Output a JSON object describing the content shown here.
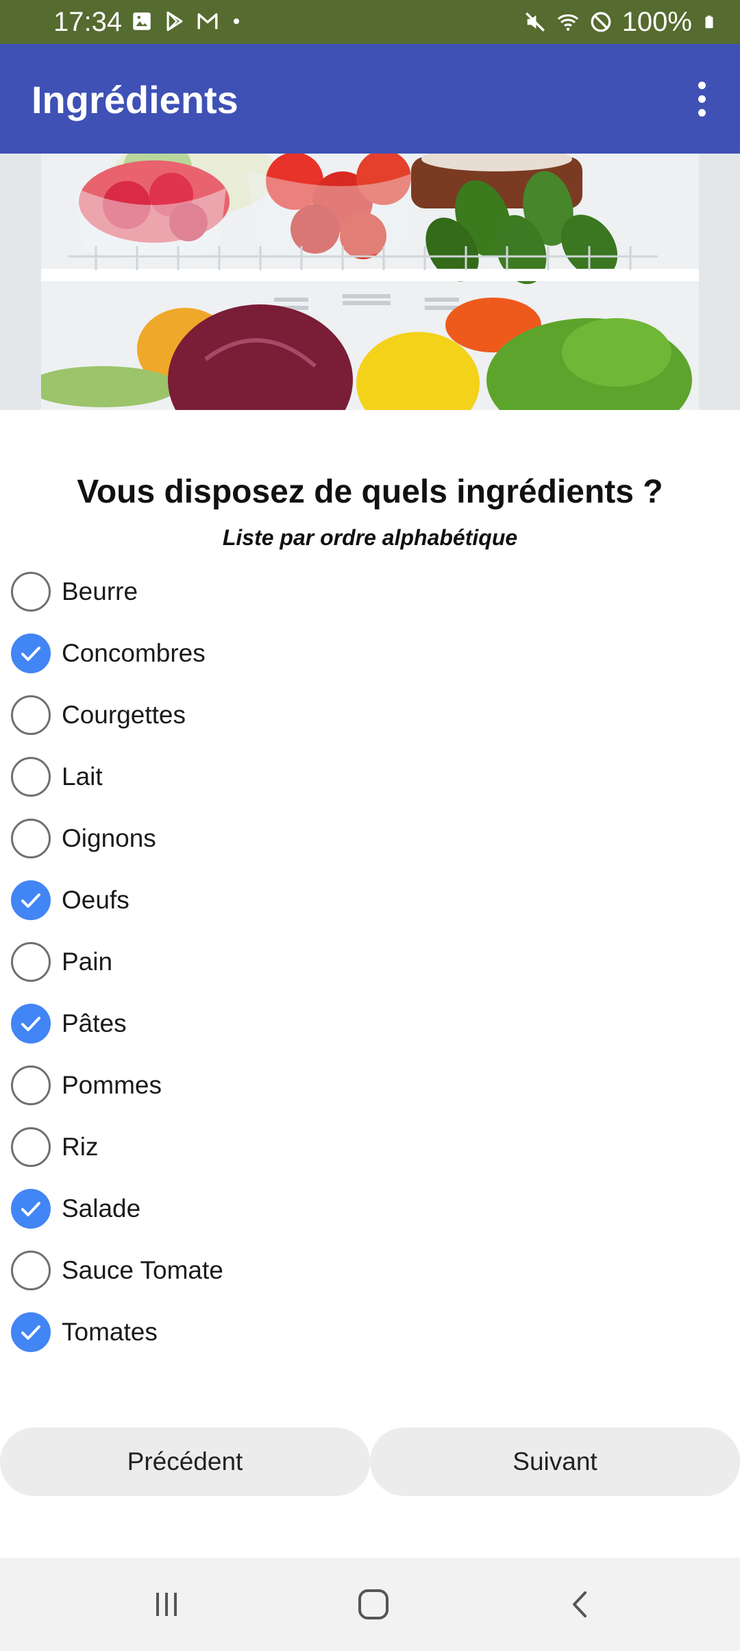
{
  "status_bar": {
    "time": "17:34",
    "battery_percent": "100%",
    "left_icons": [
      "image-icon",
      "play-store-icon",
      "gmail-icon",
      "dot-icon"
    ],
    "right_icons": [
      "mute-icon",
      "wifi-icon",
      "do-not-disturb-icon",
      "battery-icon"
    ]
  },
  "app_bar": {
    "title": "Ingrédients",
    "menu_icon": "more-vertical-icon",
    "color": "#3f51b5"
  },
  "hero": {
    "icon": "fridge-vegetables-photo"
  },
  "question": {
    "title": "Vous disposez de quels ingrédients ?",
    "subtitle": "Liste par ordre alphabétique"
  },
  "ingredients": [
    {
      "label": "Beurre",
      "checked": false
    },
    {
      "label": "Concombres",
      "checked": true
    },
    {
      "label": "Courgettes",
      "checked": false
    },
    {
      "label": "Lait",
      "checked": false
    },
    {
      "label": "Oignons",
      "checked": false
    },
    {
      "label": "Oeufs",
      "checked": true
    },
    {
      "label": "Pain",
      "checked": false
    },
    {
      "label": "Pâtes",
      "checked": true
    },
    {
      "label": "Pommes",
      "checked": false
    },
    {
      "label": "Riz",
      "checked": false
    },
    {
      "label": "Salade",
      "checked": true
    },
    {
      "label": "Sauce Tomate",
      "checked": false
    },
    {
      "label": "Tomates",
      "checked": true
    }
  ],
  "buttons": {
    "previous": "Précédent",
    "next": "Suivant"
  },
  "nav_bar": {
    "icons": [
      "recents-icon",
      "home-icon",
      "back-icon"
    ]
  },
  "colors": {
    "status_bar": "#556b2f",
    "checked": "#4285f4"
  }
}
